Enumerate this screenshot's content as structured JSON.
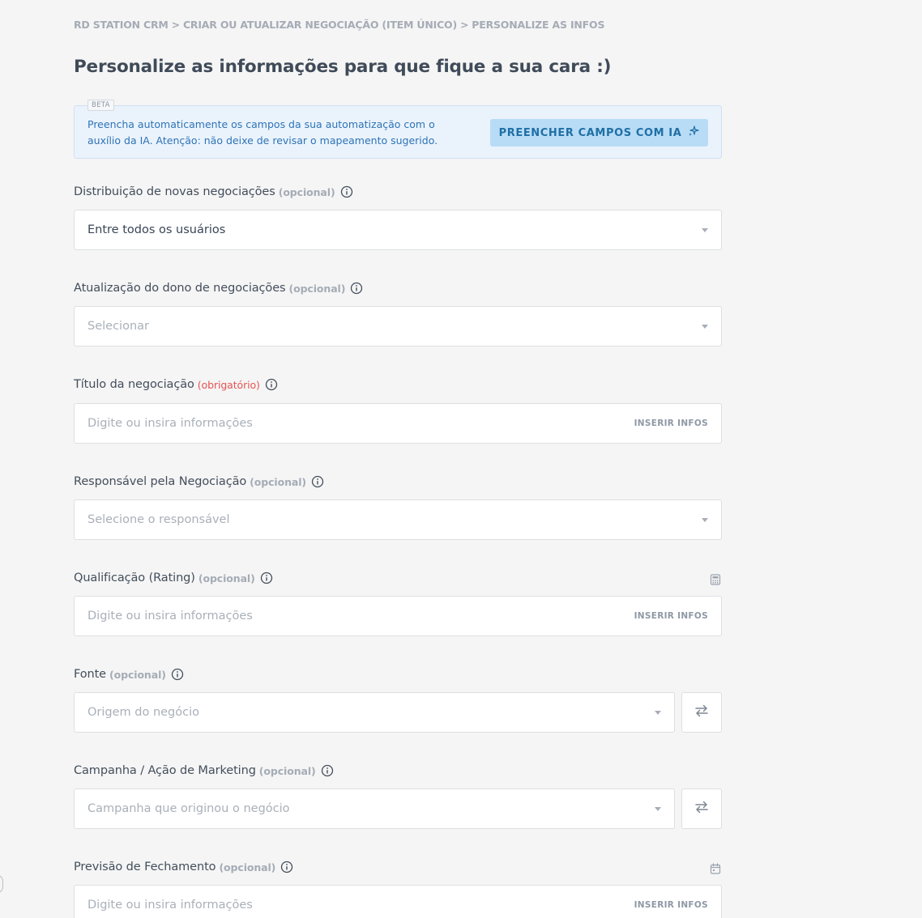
{
  "breadcrumb": {
    "items": [
      "RD STATION CRM",
      "CRIAR OU ATUALIZAR NEGOCIAÇÃO (ITEM ÚNICO)",
      "PERSONALIZE AS INFOS"
    ],
    "separator": ">"
  },
  "page_title": "Personalize as informações para que fique a sua cara :)",
  "ai_banner": {
    "badge": "BETA",
    "text": "Preencha automaticamente os campos da sua automatização com o auxílio da IA. Atenção: não deixe de revisar o mapeamento sugerido.",
    "button_label": "PREENCHER CAMPOS COM IA",
    "button_icon": "sparkle-icon"
  },
  "fields": {
    "distribuicao": {
      "label": "Distribuição de novas negociações",
      "tag": "(opcional)",
      "value": "Entre todos os usuários"
    },
    "atualizacao_dono": {
      "label": "Atualização do dono de negociações",
      "tag": "(opcional)",
      "placeholder": "Selecionar"
    },
    "titulo": {
      "label": "Título da negociação",
      "tag": "(obrigatório)",
      "placeholder": "Digite ou insira informações",
      "action": "INSERIR INFOS"
    },
    "responsavel": {
      "label": "Responsável pela Negociação",
      "tag": "(opcional)",
      "placeholder": "Selecione o responsável"
    },
    "qualificacao": {
      "label": "Qualificação (Rating)",
      "tag": "(opcional)",
      "placeholder": "Digite ou insira informações",
      "action": "INSERIR INFOS",
      "side_icon": "calculator-icon"
    },
    "fonte": {
      "label": "Fonte",
      "tag": "(opcional)",
      "placeholder": "Origem do negócio",
      "swap_icon": "swap-arrows-icon"
    },
    "campanha": {
      "label": "Campanha / Ação de Marketing",
      "tag": "(opcional)",
      "placeholder": "Campanha que originou o negócio",
      "swap_icon": "swap-arrows-icon"
    },
    "previsao": {
      "label": "Previsão de Fechamento",
      "tag": "(opcional)",
      "placeholder": "Digite ou insira informações",
      "action": "INSERIR INFOS",
      "side_icon": "calendar-icon"
    }
  },
  "colors": {
    "background": "#f5f5f5",
    "banner_background": "#eaf3fc",
    "banner_text": "#2e73b6",
    "ai_button_background": "#b8dcf6",
    "required_tag": "#e55353",
    "muted_tag": "#a5acb6"
  }
}
